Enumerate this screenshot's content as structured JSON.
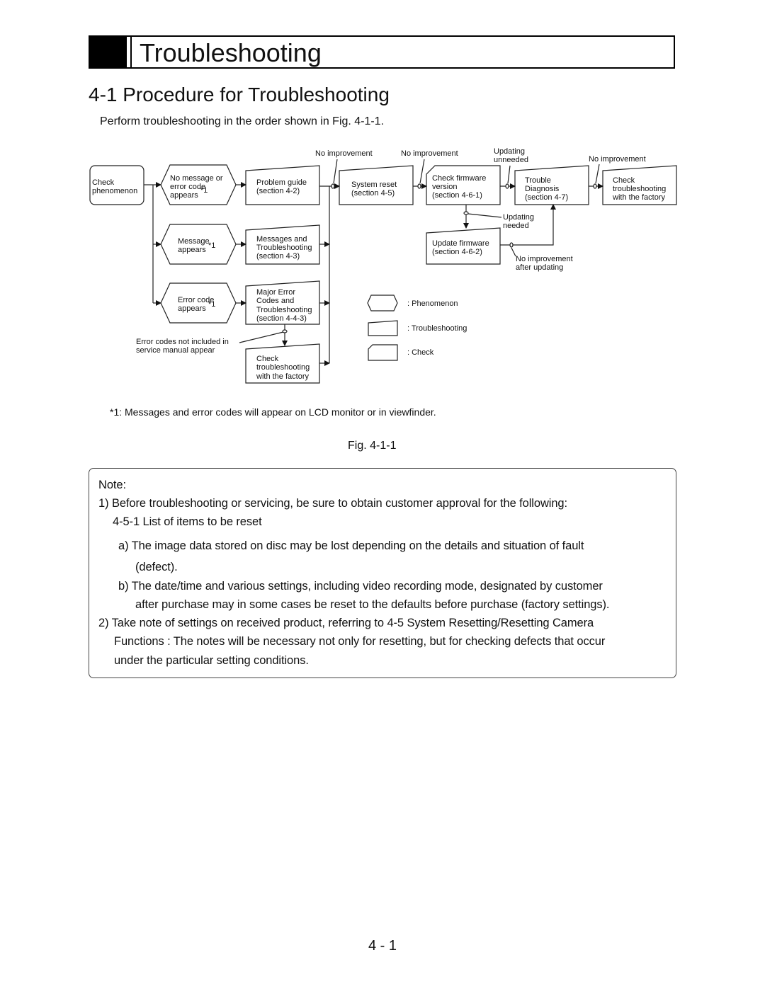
{
  "header": {
    "title": "Troubleshooting"
  },
  "section": {
    "heading": "4-1 Procedure for Troubleshooting",
    "intro": "Perform troubleshooting in the order shown in Fig. 4-1-1."
  },
  "diagram": {
    "nodes": {
      "check_phenomenon": [
        "Check",
        "phenomenon"
      ],
      "no_message": [
        "No message or",
        "error code",
        "appears"
      ],
      "message_appears": [
        "Message",
        "appears"
      ],
      "error_code_appears": [
        "Error code",
        "appears"
      ],
      "problem_guide": [
        "Problem guide",
        "(section 4-2)"
      ],
      "messages_troubleshooting": [
        "Messages and",
        "Troubleshooting",
        "(section 4-3)"
      ],
      "major_error_codes": [
        "Major Error",
        "Codes and",
        "Troubleshooting",
        "(section 4-4-3)"
      ],
      "check_factory_bottom": [
        "Check",
        "troubleshooting",
        "with the factory"
      ],
      "system_reset": [
        "System reset",
        "(section 4-5)"
      ],
      "check_firmware": [
        "Check firmware",
        "version",
        "(section 4-6-1)"
      ],
      "trouble_diagnosis": [
        "Trouble",
        "Diagnosis",
        "(section 4-7)"
      ],
      "check_factory_top": [
        "Check",
        "troubleshooting",
        "with the factory"
      ],
      "update_firmware": [
        "Update firmware",
        "(section 4-6-2)"
      ]
    },
    "superscript": "*1",
    "edge_labels": {
      "no_improvement_1": "No improvement",
      "no_improvement_2": "No improvement",
      "updating_unneeded": [
        "Updating",
        "unneeded"
      ],
      "no_improvement_3": "No improvement",
      "updating_needed": [
        "Updating",
        "needed"
      ],
      "no_improvement_after_updating": [
        "No improvement",
        "after updating"
      ],
      "error_codes_not_included": [
        "Error codes not included in",
        "service manual appear"
      ]
    },
    "legend": [
      {
        "shape": "hexagon",
        "label": ": Phenomenon"
      },
      {
        "shape": "slanted-top",
        "label": ": Troubleshooting"
      },
      {
        "shape": "cut-corner",
        "label": ": Check"
      }
    ]
  },
  "footnote": "*1: Messages and error codes will appear on LCD monitor or in viewfinder.",
  "figure_caption": "Fig. 4-1-1",
  "note": {
    "title": "Note:",
    "lines": [
      "1) Before troubleshooting or servicing, be sure to obtain customer approval for the following:",
      "4-5-1 List of items to be reset",
      "a) The image data stored on disc may be lost depending on the details and situation of fault",
      "(defect).",
      "b) The date/time and various settings, including video recording mode, designated by customer",
      "after purchase may in some cases be reset to the defaults before purchase (factory settings).",
      "2) Take note of settings on received product, referring to  4-5 System Resetting/Resetting Camera",
      "Functions : The notes will be necessary not only for resetting, but for checking defects that occur",
      "under the particular setting conditions."
    ]
  },
  "page_number": "4 - 1"
}
